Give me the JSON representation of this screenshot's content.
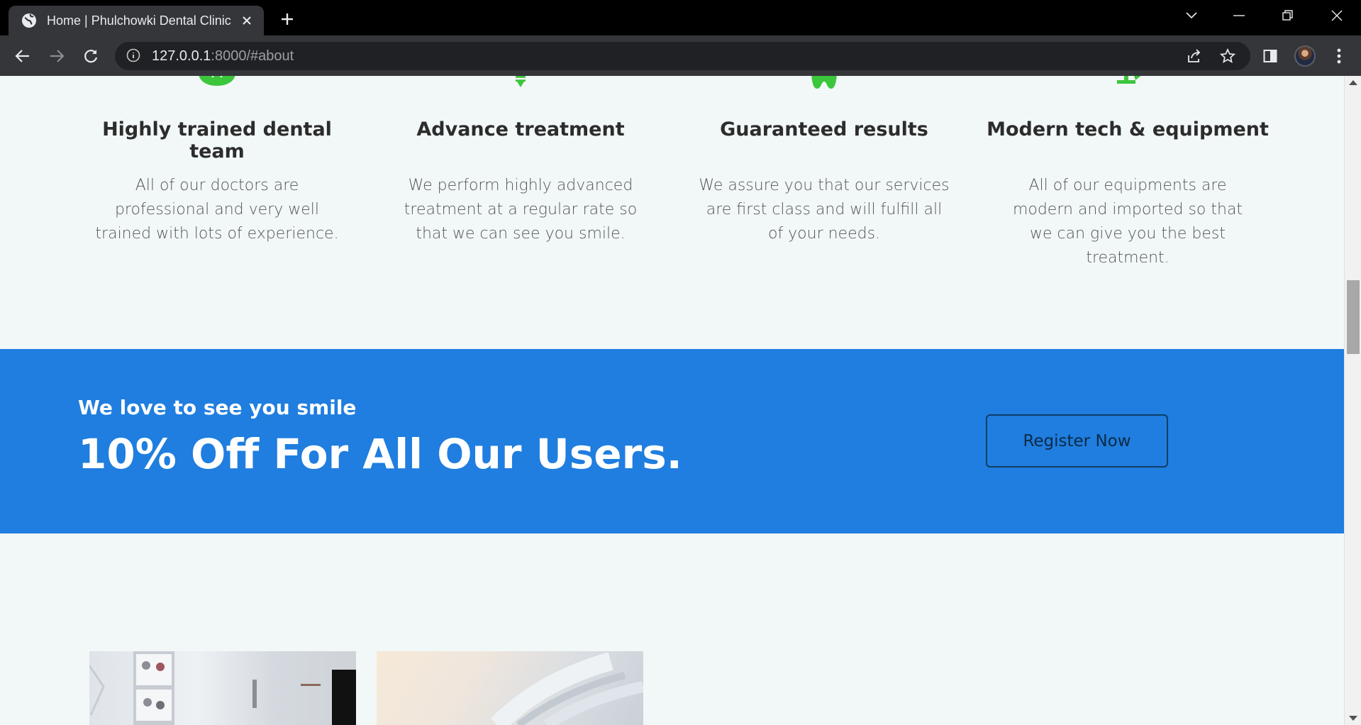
{
  "browser": {
    "tab_title": "Home | Phulchowki Dental Clinic",
    "url_host": "127.0.0.1",
    "url_rest": ":8000/#about",
    "icons": {
      "favicon": "globe-icon",
      "close": "close-icon",
      "new_tab": "plus-icon",
      "back": "arrow-left-icon",
      "forward": "arrow-right-icon",
      "reload": "reload-icon",
      "site_info": "info-icon",
      "share": "share-icon",
      "bookmark": "star-icon",
      "side_panel": "side-panel-icon",
      "menu": "kebab-menu-icon"
    }
  },
  "features": [
    {
      "title": "Highly trained dental team",
      "text": "All of our doctors are professional and very well trained with lots of experience.",
      "icon": "dentist-team-icon"
    },
    {
      "title": "Advance treatment",
      "text": "We perform highly advanced treatment at a regular rate so that we can see you smile.",
      "icon": "dental-implant-icon"
    },
    {
      "title": "Guaranteed results",
      "text": "We assure you that our services are first class and will fulfill all of your needs.",
      "icon": "tooth-icon"
    },
    {
      "title": "Modern tech & equipment",
      "text": "All of our equipments are modern and imported so that we can give you the best treatment.",
      "icon": "dental-chair-icon"
    }
  ],
  "promo": {
    "subtitle": "We love to see you smile",
    "headline": "10% Off For All Our Users.",
    "button_label": "Register Now"
  },
  "colors": {
    "accent_green": "#3cc63c",
    "promo_blue": "#1f7edf",
    "page_bg": "#f2f8f8"
  }
}
